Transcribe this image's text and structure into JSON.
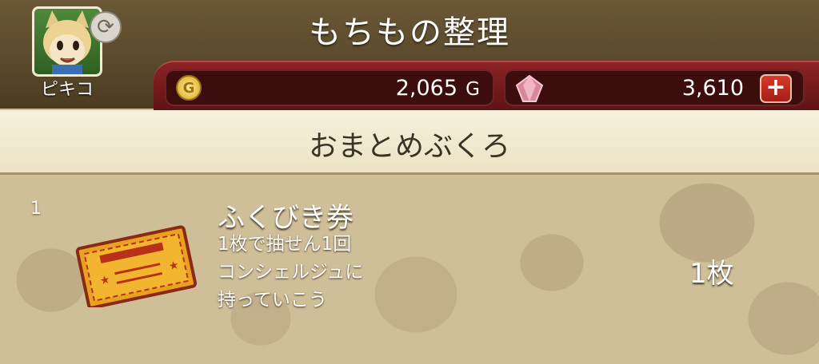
{
  "header": {
    "title": "もちもの整理",
    "character_name": "ピキコ"
  },
  "currency": {
    "gold_value": "2,065",
    "gold_unit": "G",
    "gold_icon_glyph": "G",
    "gem_value": "3,610",
    "plus_label": "+"
  },
  "section": {
    "title": "おまとめぶくろ"
  },
  "item": {
    "index": "1",
    "name": "ふくびき券",
    "description": [
      "1枚で抽せん1回",
      "コンシェルジュに",
      "持っていこう"
    ],
    "count": "1枚"
  },
  "icons": {
    "swap": "swap-icon",
    "coin": "gold-coin-icon",
    "gem": "gem-icon",
    "ticket": "lottery-ticket-icon"
  },
  "colors": {
    "header_brown": "#5b4a2c",
    "currency_red": "#8d2325",
    "plus_red": "#d83a2a",
    "band_cream": "#f6f1dc",
    "content_tan": "#cfbf99"
  }
}
